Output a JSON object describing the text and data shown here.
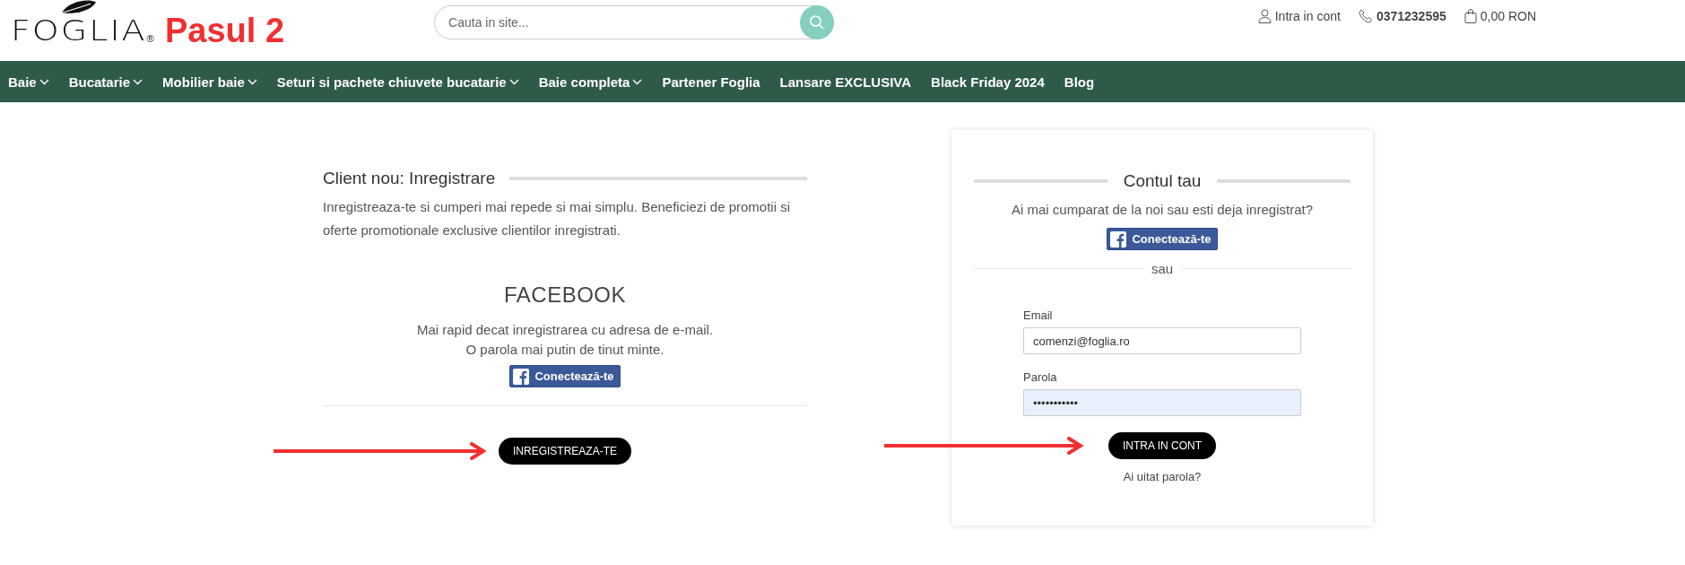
{
  "header": {
    "logo": "FOGLIA",
    "logo_mark": "®",
    "step_label": "Pasul 2",
    "search": {
      "placeholder": "Cauta in site..."
    },
    "account_link": "Intra in cont",
    "phone": "0371232595",
    "cart_total": "0,00 RON"
  },
  "nav": [
    {
      "label": "Baie",
      "has_dropdown": true
    },
    {
      "label": "Bucatarie",
      "has_dropdown": true
    },
    {
      "label": "Mobilier baie",
      "has_dropdown": true
    },
    {
      "label": "Seturi si pachete chiuvete bucatarie",
      "has_dropdown": true
    },
    {
      "label": "Baie completa",
      "has_dropdown": true
    },
    {
      "label": "Partener Foglia",
      "has_dropdown": false
    },
    {
      "label": "Lansare EXCLUSIVA",
      "has_dropdown": false
    },
    {
      "label": "Black Friday 2024",
      "has_dropdown": false
    },
    {
      "label": "Blog",
      "has_dropdown": false
    }
  ],
  "register": {
    "title": "Client nou: Inregistrare",
    "description": "Inregistreaza-te si cumperi mai repede si mai simplu. Beneficiezi de promotii si oferte promotionale exclusive clientilor inregistrati.",
    "facebook_heading": "FACEBOOK",
    "facebook_text": [
      "Mai rapid decat inregistrarea cu adresa de e-mail.",
      "O parola mai putin de tinut minte."
    ],
    "facebook_button": "Conectează-te",
    "submit_button": "INREGISTREAZA-TE",
    "pointer_arrow": true
  },
  "login": {
    "title": "Contul tau",
    "question": "Ai mai cumparat de la noi sau esti deja inregistrat?",
    "facebook_button": "Conectează-te",
    "divider_text": "sau",
    "fields": [
      {
        "label": "Email",
        "value": "comenzi@foglia.ro",
        "autofilled": false
      },
      {
        "label": "Parola",
        "value": "•••••••••••",
        "autofilled": true
      }
    ],
    "submit_button": "INTRA IN CONT",
    "pointer_arrow": true,
    "forgot_link": "Ai uitat parola?"
  }
}
